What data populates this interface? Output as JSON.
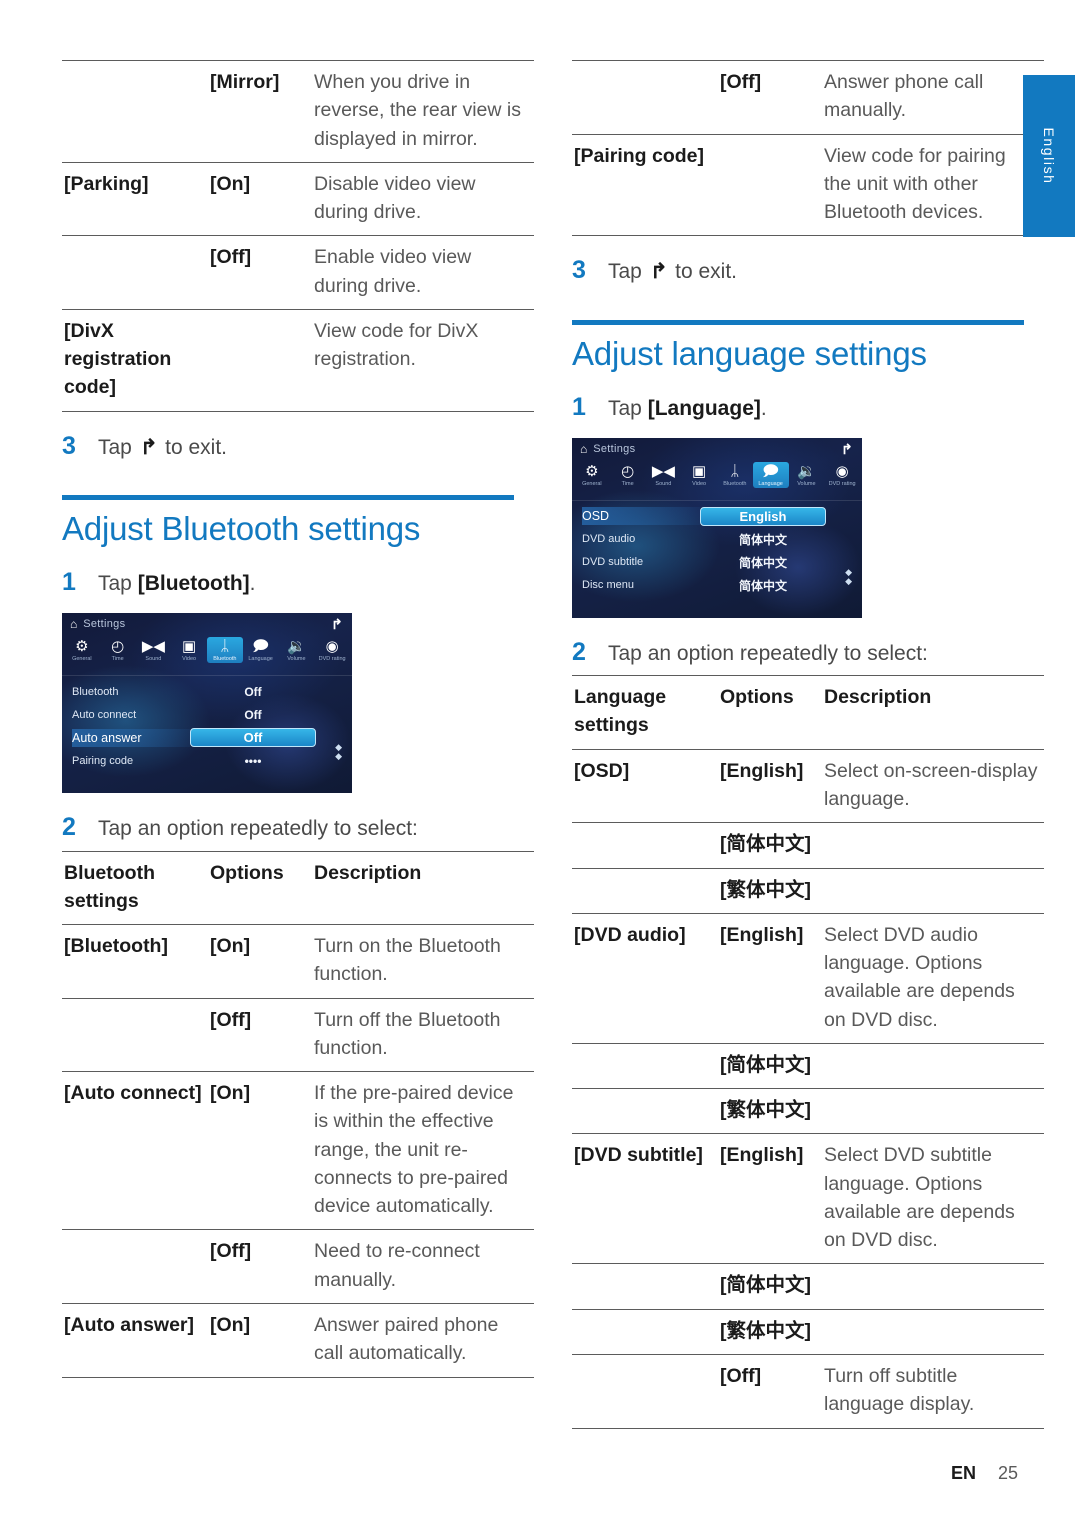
{
  "side_tab": {
    "label": "English"
  },
  "footer": {
    "lang_code": "EN",
    "page_number": "25"
  },
  "left_column": {
    "video_table": {
      "rows": [
        {
          "setting": "",
          "option": "[Mirror]",
          "description": "When you drive in reverse, the rear view is displayed in mirror."
        },
        {
          "setting": "[Parking]",
          "option": "[On]",
          "description": "Disable video view during drive."
        },
        {
          "setting": "",
          "option": "[Off]",
          "description": "Enable video view during drive."
        },
        {
          "setting": "[DivX registration code]",
          "option": "",
          "description": "View code for DivX registration."
        }
      ]
    },
    "exit_step": {
      "num": "3",
      "pre": "Tap",
      "icon": "back-arrow-icon",
      "post": "to exit."
    },
    "section": {
      "title": "Adjust Bluetooth settings",
      "step1": {
        "num": "1",
        "pre": "Tap",
        "target": "[Bluetooth]",
        "post": "."
      },
      "screenshot": {
        "title": "Settings",
        "home_icon": "home-icon",
        "back_icon": "back-arrow-icon",
        "icons": [
          {
            "label": "General",
            "glyph": "⚙",
            "selected": false
          },
          {
            "label": "Time",
            "glyph": "◴",
            "selected": false
          },
          {
            "label": "Sound",
            "glyph": "▶◀",
            "selected": false
          },
          {
            "label": "Video",
            "glyph": "▣",
            "selected": false
          },
          {
            "label": "Bluetooth",
            "glyph": "ᛦ",
            "selected": true
          },
          {
            "label": "Language",
            "glyph": "὞9",
            "selected": false
          },
          {
            "label": "Volume",
            "glyph": "◀)",
            "selected": false
          },
          {
            "label": "DVD rating",
            "glyph": "◉",
            "selected": false
          }
        ],
        "rows": [
          {
            "label": "Bluetooth",
            "value": "Off",
            "highlighted": false
          },
          {
            "label": "Auto connect",
            "value": "Off",
            "highlighted": false
          },
          {
            "label": "Auto answer",
            "value": "Off",
            "highlighted": true
          },
          {
            "label": "Pairing code",
            "value": "••••",
            "highlighted": false
          }
        ]
      },
      "step2": {
        "num": "2",
        "text": "Tap an option repeatedly to select:"
      },
      "table": {
        "headers": {
          "c1": "Bluetooth settings",
          "c2": "Options",
          "c3": "Description"
        },
        "rows": [
          {
            "setting": "[Bluetooth]",
            "option": "[On]",
            "description": "Turn on the Bluetooth function."
          },
          {
            "setting": "",
            "option": "[Off]",
            "description": "Turn off the Bluetooth function."
          },
          {
            "setting": "[Auto connect]",
            "option": "[On]",
            "description": "If the pre-paired device is within the effective range, the unit re-connects to pre-paired device automatically."
          },
          {
            "setting": "",
            "option": "[Off]",
            "description": "Need to re-connect manually."
          },
          {
            "setting": "[Auto answer]",
            "option": "[On]",
            "description": "Answer paired phone call automatically."
          }
        ]
      }
    }
  },
  "right_column": {
    "bluetooth_table_cont": {
      "rows": [
        {
          "setting": "",
          "option": "[Off]",
          "description": "Answer phone call manually."
        },
        {
          "setting": "[Pairing code]",
          "option": "",
          "description": "View code for pairing the unit with other Bluetooth devices."
        }
      ]
    },
    "exit_step": {
      "num": "3",
      "pre": "Tap",
      "icon": "back-arrow-icon",
      "post": "to exit."
    },
    "section": {
      "title": "Adjust language settings",
      "step1": {
        "num": "1",
        "pre": "Tap",
        "target": "[Language]",
        "post": "."
      },
      "screenshot": {
        "title": "Settings",
        "home_icon": "home-icon",
        "back_icon": "back-arrow-icon",
        "icons": [
          {
            "label": "General",
            "glyph": "⚙",
            "selected": false
          },
          {
            "label": "Time",
            "glyph": "◴",
            "selected": false
          },
          {
            "label": "Sound",
            "glyph": "▶◀",
            "selected": false
          },
          {
            "label": "Video",
            "glyph": "▣",
            "selected": false
          },
          {
            "label": "Bluetooth",
            "glyph": "ᛦ",
            "selected": false
          },
          {
            "label": "Language",
            "glyph": "὞9",
            "selected": true
          },
          {
            "label": "Volume",
            "glyph": "◀)",
            "selected": false
          },
          {
            "label": "DVD rating",
            "glyph": "◉",
            "selected": false
          }
        ],
        "rows": [
          {
            "label": "OSD",
            "value": "English",
            "highlighted": true
          },
          {
            "label": "DVD audio",
            "value": "简体中文",
            "highlighted": false
          },
          {
            "label": "DVD subtitle",
            "value": "简体中文",
            "highlighted": false
          },
          {
            "label": "Disc menu",
            "value": "简体中文",
            "highlighted": false
          }
        ]
      },
      "step2": {
        "num": "2",
        "text": "Tap an option repeatedly to select:"
      },
      "table": {
        "headers": {
          "c1": "Language settings",
          "c2": "Options",
          "c3": "Description"
        },
        "rows": [
          {
            "setting": "[OSD]",
            "option": "[English]",
            "description": "Select on-screen-display language."
          },
          {
            "setting": "",
            "option": "[简体中文]",
            "description": ""
          },
          {
            "setting": "",
            "option": "[繁体中文]",
            "description": ""
          },
          {
            "setting": "[DVD audio]",
            "option": "[English]",
            "description": "Select DVD audio language. Options available are depends on DVD disc."
          },
          {
            "setting": "",
            "option": "[简体中文]",
            "description": ""
          },
          {
            "setting": "",
            "option": "[繁体中文]",
            "description": ""
          },
          {
            "setting": "[DVD subtitle]",
            "option": "[English]",
            "description": "Select DVD subtitle language. Options available are depends on DVD disc."
          },
          {
            "setting": "",
            "option": "[简体中文]",
            "description": ""
          },
          {
            "setting": "",
            "option": "[繁体中文]",
            "description": ""
          },
          {
            "setting": "",
            "option": "[Off]",
            "description": "Turn off subtitle language display."
          }
        ]
      }
    }
  }
}
